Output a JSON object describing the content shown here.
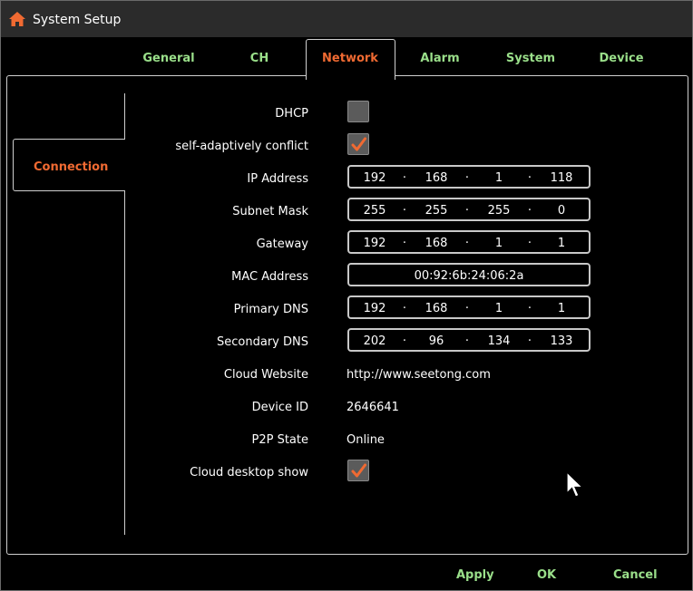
{
  "window": {
    "title": "System Setup"
  },
  "tabs": [
    {
      "label": "General"
    },
    {
      "label": "CH"
    },
    {
      "label": "Network"
    },
    {
      "label": "Alarm"
    },
    {
      "label": "System"
    },
    {
      "label": "Device"
    }
  ],
  "sidebar": {
    "items": [
      {
        "label": "Connection"
      }
    ]
  },
  "form": {
    "dhcp": {
      "label": "DHCP",
      "checked": false
    },
    "conflict": {
      "label": "self-adaptively conflict",
      "checked": true
    },
    "ip": {
      "label": "IP Address",
      "octets": [
        "192",
        "168",
        "1",
        "118"
      ]
    },
    "mask": {
      "label": "Subnet Mask",
      "octets": [
        "255",
        "255",
        "255",
        "0"
      ]
    },
    "gateway": {
      "label": "Gateway",
      "octets": [
        "192",
        "168",
        "1",
        "1"
      ]
    },
    "mac": {
      "label": "MAC Address",
      "value": "00:92:6b:24:06:2a"
    },
    "dns1": {
      "label": "Primary DNS",
      "octets": [
        "192",
        "168",
        "1",
        "1"
      ]
    },
    "dns2": {
      "label": "Secondary DNS",
      "octets": [
        "202",
        "96",
        "134",
        "133"
      ]
    },
    "cloud_website": {
      "label": "Cloud Website",
      "value": "http://www.seetong.com"
    },
    "device_id": {
      "label": "Device ID",
      "value": "2646641"
    },
    "p2p_state": {
      "label": "P2P State",
      "value": "Online"
    },
    "cloud_desktop": {
      "label": "Cloud desktop show",
      "checked": true
    }
  },
  "footer": {
    "apply": "Apply",
    "ok": "OK",
    "cancel": "Cancel"
  },
  "icons": {
    "home": "home-icon",
    "check": "checkmark-icon",
    "cursor": "mouse-pointer-icon"
  },
  "colors": {
    "accent": "#f06a32",
    "tab_text": "#9adf8a",
    "background": "#000000",
    "titlebar": "#2b2b2b"
  }
}
